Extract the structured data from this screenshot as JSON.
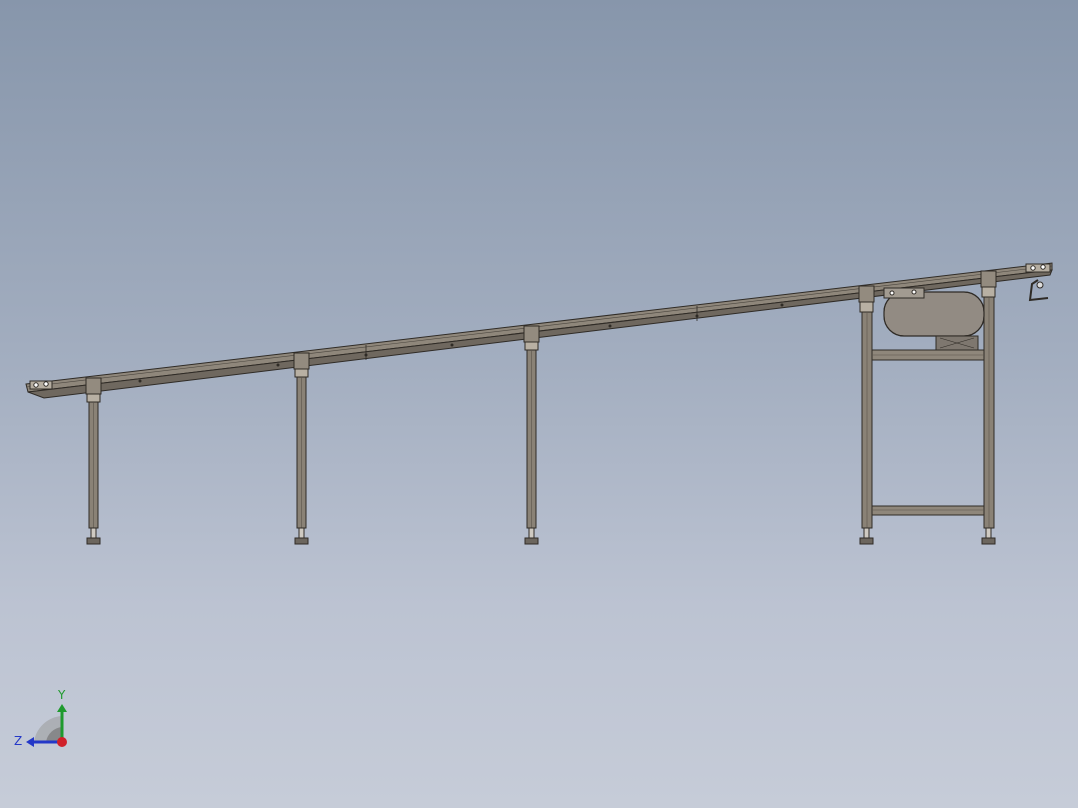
{
  "triad": {
    "y_label": "Y",
    "z_label": "Z",
    "colors": {
      "y_axis": "#1f9a2e",
      "z_axis": "#2438c8",
      "x_axis": "#d0202a"
    }
  },
  "colors": {
    "frame": "#8a8276",
    "frame_dark": "#3a3630",
    "motor": "#918a82"
  }
}
